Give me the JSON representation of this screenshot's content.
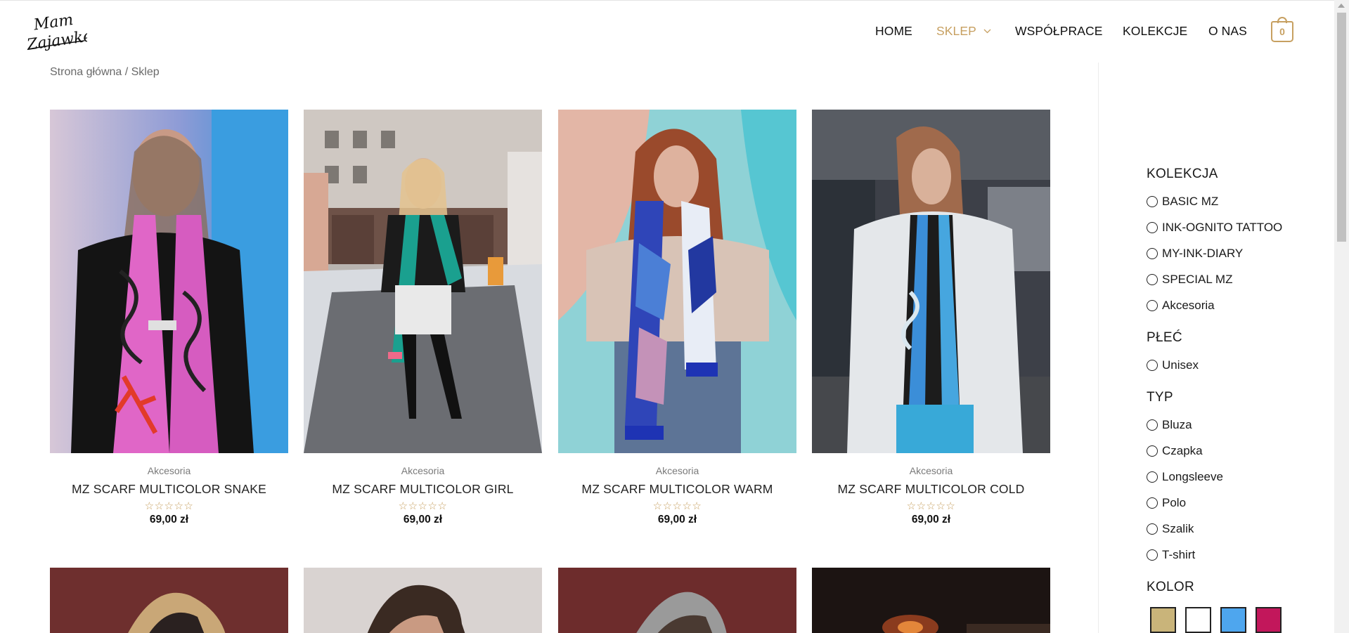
{
  "brand": {
    "logo_text_line1": "Mam",
    "logo_text_line2": "Zajawkę"
  },
  "nav": {
    "items": [
      "HOME",
      "SKLEP",
      "WSPÓŁPRACE",
      "KOLEKCJE",
      "O NAS"
    ],
    "active_index": 1,
    "cart_count": "0"
  },
  "colors": {
    "accent": "#c7a061",
    "text": "#222222"
  },
  "breadcrumb": "Strona główna / Sklep",
  "products": [
    {
      "category": "Akcesoria",
      "title": "MZ SCARF MULTICOLOR SNAKE",
      "stars": "☆☆☆☆☆",
      "price": "69,00 zł"
    },
    {
      "category": "Akcesoria",
      "title": "MZ SCARF MULTICOLOR GIRL",
      "stars": "☆☆☆☆☆",
      "price": "69,00 zł"
    },
    {
      "category": "Akcesoria",
      "title": "MZ SCARF MULTICOLOR WARM",
      "stars": "☆☆☆☆☆",
      "price": "69,00 zł"
    },
    {
      "category": "Akcesoria",
      "title": "MZ SCARF MULTICOLOR COLD",
      "stars": "☆☆☆☆☆",
      "price": "69,00 zł"
    }
  ],
  "filters": {
    "kolekcja": {
      "title": "KOLEKCJA",
      "options": [
        "BASIC MZ",
        "INK-OGNITO TATTOO",
        "MY-INK-DIARY",
        "SPECIAL MZ",
        "Akcesoria"
      ]
    },
    "plec": {
      "title": "PŁEĆ",
      "options": [
        "Unisex"
      ]
    },
    "typ": {
      "title": "TYP",
      "options": [
        "Bluza",
        "Czapka",
        "Longsleeve",
        "Polo",
        "Szalik",
        "T-shirt"
      ]
    },
    "kolor": {
      "title": "KOLOR",
      "swatches": [
        "#c9b47a",
        "#ffffff",
        "#4ea6ee",
        "#c2175b"
      ]
    }
  }
}
